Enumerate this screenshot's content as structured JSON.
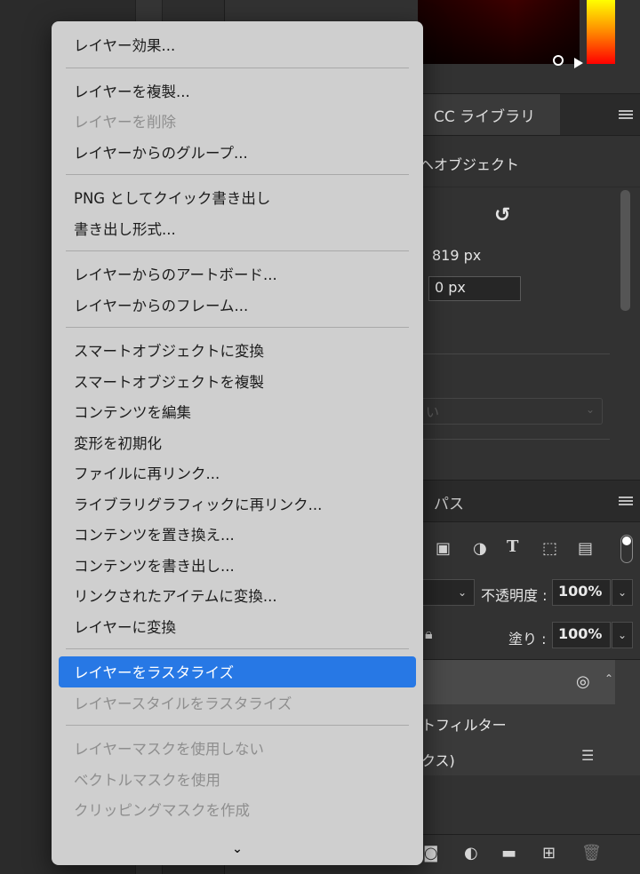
{
  "menu": {
    "groups": [
      [
        {
          "label": "レイヤー効果...",
          "state": "normal"
        }
      ],
      [
        {
          "label": "レイヤーを複製...",
          "state": "normal"
        },
        {
          "label": "レイヤーを削除",
          "state": "disabled"
        },
        {
          "label": "レイヤーからのグループ...",
          "state": "normal"
        }
      ],
      [
        {
          "label": "PNG としてクイック書き出し",
          "state": "normal"
        },
        {
          "label": "書き出し形式...",
          "state": "normal"
        }
      ],
      [
        {
          "label": "レイヤーからのアートボード...",
          "state": "normal"
        },
        {
          "label": "レイヤーからのフレーム...",
          "state": "normal"
        }
      ],
      [
        {
          "label": "スマートオブジェクトに変換",
          "state": "normal"
        },
        {
          "label": "スマートオブジェクトを複製",
          "state": "normal"
        },
        {
          "label": "コンテンツを編集",
          "state": "normal"
        },
        {
          "label": "変形を初期化",
          "state": "normal"
        },
        {
          "label": "ファイルに再リンク...",
          "state": "normal"
        },
        {
          "label": "ライブラリグラフィックに再リンク...",
          "state": "normal"
        },
        {
          "label": "コンテンツを置き換え...",
          "state": "normal"
        },
        {
          "label": "コンテンツを書き出し...",
          "state": "normal"
        },
        {
          "label": "リンクされたアイテムに変換...",
          "state": "normal"
        },
        {
          "label": "レイヤーに変換",
          "state": "normal"
        }
      ],
      [
        {
          "label": "レイヤーをラスタライズ",
          "state": "selected"
        },
        {
          "label": "レイヤースタイルをラスタライズ",
          "state": "disabled"
        }
      ],
      [
        {
          "label": "レイヤーマスクを使用しない",
          "state": "disabled"
        },
        {
          "label": "ベクトルマスクを使用",
          "state": "disabled"
        },
        {
          "label": "クリッピングマスクを作成",
          "state": "disabled"
        }
      ]
    ],
    "scroll_indicator": "⌄"
  },
  "panels": {
    "libraries_tab": "CC ライブラリ",
    "smart_object_label": "ヘオブジェクト",
    "reset_icon": "↺",
    "width_value": "819 px",
    "offset_value": "0 px",
    "faded_select": "い",
    "paths_tab": "パス",
    "opacity_label": "不透明度 :",
    "opacity_value": "100%",
    "fill_label": "塗り :",
    "fill_value": "100%",
    "smart_filter_label": "トフィルター",
    "layer_sub_label": "クス)"
  },
  "colors": {
    "menu_bg": "#cfcfcf",
    "highlight": "#2778e5",
    "disabled_text": "#8e8e8e"
  }
}
